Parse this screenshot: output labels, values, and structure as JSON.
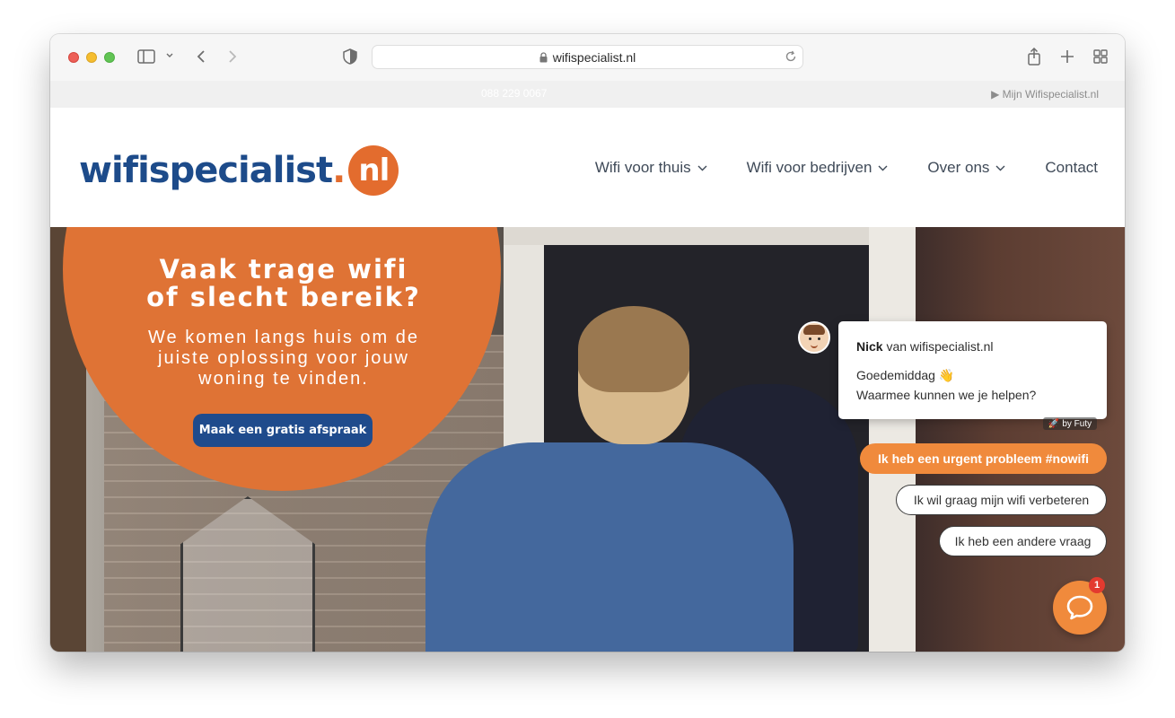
{
  "browser": {
    "url": "wifispecialist.nl"
  },
  "infobar": {
    "phone": "088 229 0067",
    "account_link": "▶ Mijn Wifispecialist.nl"
  },
  "logo": {
    "main": "wifispecialist",
    "dot": ".",
    "tld": "nl"
  },
  "nav": {
    "items": [
      {
        "label": "Wifi voor thuis",
        "dropdown": true
      },
      {
        "label": "Wifi voor bedrijven",
        "dropdown": true
      },
      {
        "label": "Over ons",
        "dropdown": true
      },
      {
        "label": "Contact",
        "dropdown": false
      }
    ]
  },
  "hero": {
    "title": "Vaak trage wifi of slecht bereik?",
    "subtitle": "We komen langs huis om de juiste oplossing voor jouw woning te vinden.",
    "cta_label": "Maak een gratis afspraak"
  },
  "chat": {
    "agent_name": "Nick",
    "agent_suffix": " van wifispecialist.nl",
    "message_line1": "Goedemiddag 👋",
    "message_line2": "Waarmee kunnen we je helpen?",
    "powered_by": "by Futy",
    "options": [
      "Ik heb een urgent probleem #nowifi",
      "Ik wil graag mijn wifi verbeteren",
      "Ik heb een andere vraag"
    ],
    "unread_count": "1"
  },
  "colors": {
    "brand_blue": "#1d4b8a",
    "brand_orange": "#df7335",
    "chat_orange": "#f08a3c"
  }
}
